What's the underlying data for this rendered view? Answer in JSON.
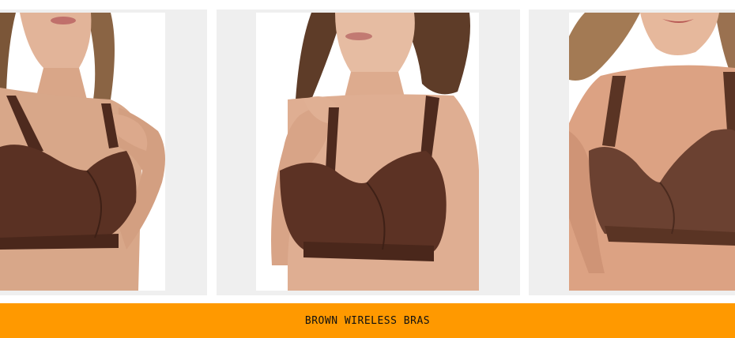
{
  "gallery": {
    "items": [
      {
        "icon": "product-photo",
        "alt_subject": "woman wearing brown wireless bra, hand on strap"
      },
      {
        "icon": "product-photo",
        "alt_subject": "woman wearing brown wireless bra, hand on strap"
      },
      {
        "icon": "product-photo",
        "alt_subject": "woman wearing brown wireless bra"
      }
    ]
  },
  "banner": {
    "label": "BROWN WIRELESS BRAS",
    "background": "#ff9900"
  },
  "colors": {
    "card_bg": "#efefef",
    "skin": "#d8a789",
    "bra": "#5a3123",
    "hair": "#6b4a33"
  }
}
